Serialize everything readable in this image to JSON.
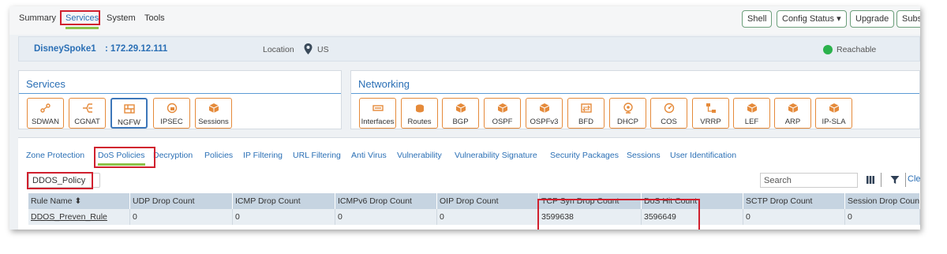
{
  "top_tabs": [
    "Summary",
    "Services",
    "System",
    "Tools"
  ],
  "top_buttons": {
    "shell": "Shell",
    "config_status": "Config Status ▾",
    "upgrade": "Upgrade",
    "subs": "Subs"
  },
  "device": {
    "name": "DisneySpoke1",
    "ip": ": 172.29.12.111",
    "location_label": "Location",
    "location_value": "US",
    "status": "Reachable"
  },
  "services_panel": {
    "title": "Services",
    "tiles": [
      "SDWAN",
      "CGNAT",
      "NGFW",
      "IPSEC",
      "Sessions"
    ]
  },
  "networking_panel": {
    "title": "Networking",
    "tiles": [
      "Interfaces",
      "Routes",
      "BGP",
      "OSPF",
      "OSPFv3",
      "BFD",
      "DHCP",
      "COS",
      "VRRP",
      "LEF",
      "ARP",
      "IP-SLA"
    ]
  },
  "sub_tabs": [
    "Zone Protection",
    "DoS Policies",
    "Decryption",
    "Policies",
    "IP Filtering",
    "URL Filtering",
    "Anti Virus",
    "Vulnerability",
    "Vulnerability Signature",
    "Security Packages",
    "Sessions",
    "User Identification"
  ],
  "policy_select": "DDOS_Policy",
  "search_placeholder": "Search",
  "clear_label": "Cle",
  "table": {
    "columns": [
      "Rule Name ⬍",
      "UDP Drop Count",
      "ICMP Drop Count",
      "ICMPv6 Drop Count",
      "OIP Drop Count",
      "TCP Syn Drop Count",
      "DoS Hit Count",
      "SCTP Drop Count",
      "Session Drop Count"
    ],
    "rows": [
      [
        "DDOS_Preven_Rule",
        "0",
        "0",
        "0",
        "0",
        "3599638",
        "3596649",
        "0",
        "0"
      ]
    ]
  },
  "colors": {
    "accent": "#2a6fb5",
    "tile_border": "#e58a3a",
    "active_underline": "#8dc34a",
    "highlight": "#d0202e",
    "status_ok": "#2bb24c"
  }
}
